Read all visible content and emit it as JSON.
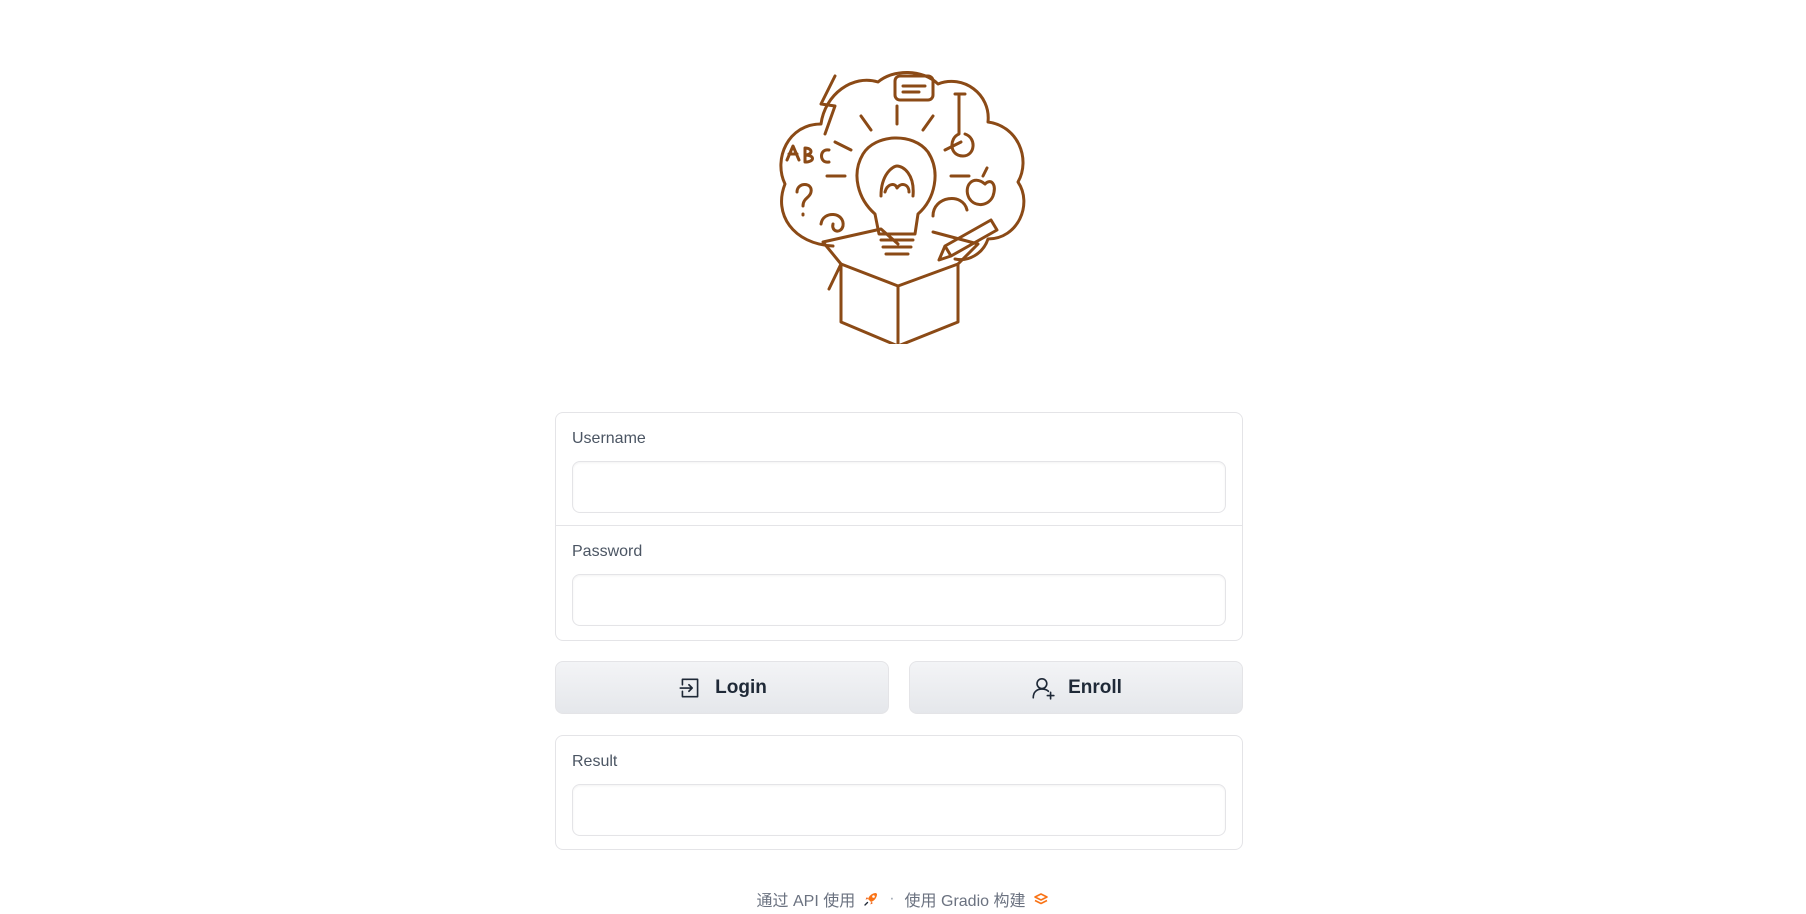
{
  "logo": {
    "icon": "idea-box-icon",
    "color": "#8b4a16"
  },
  "form": {
    "username": {
      "label": "Username",
      "value": "",
      "placeholder": ""
    },
    "password": {
      "label": "Password",
      "value": "",
      "placeholder": ""
    }
  },
  "buttons": {
    "login": {
      "label": "Login",
      "icon": "login-icon"
    },
    "enroll": {
      "label": "Enroll",
      "icon": "add-user-icon"
    }
  },
  "result": {
    "label": "Result",
    "value": "",
    "placeholder": ""
  },
  "footer": {
    "api_link": "通过 API 使用",
    "api_icon": "rocket-icon",
    "separator": "·",
    "built_with": "使用 Gradio 构建",
    "gradio_icon": "gradio-logo-icon",
    "accent_color": "#f97316"
  }
}
